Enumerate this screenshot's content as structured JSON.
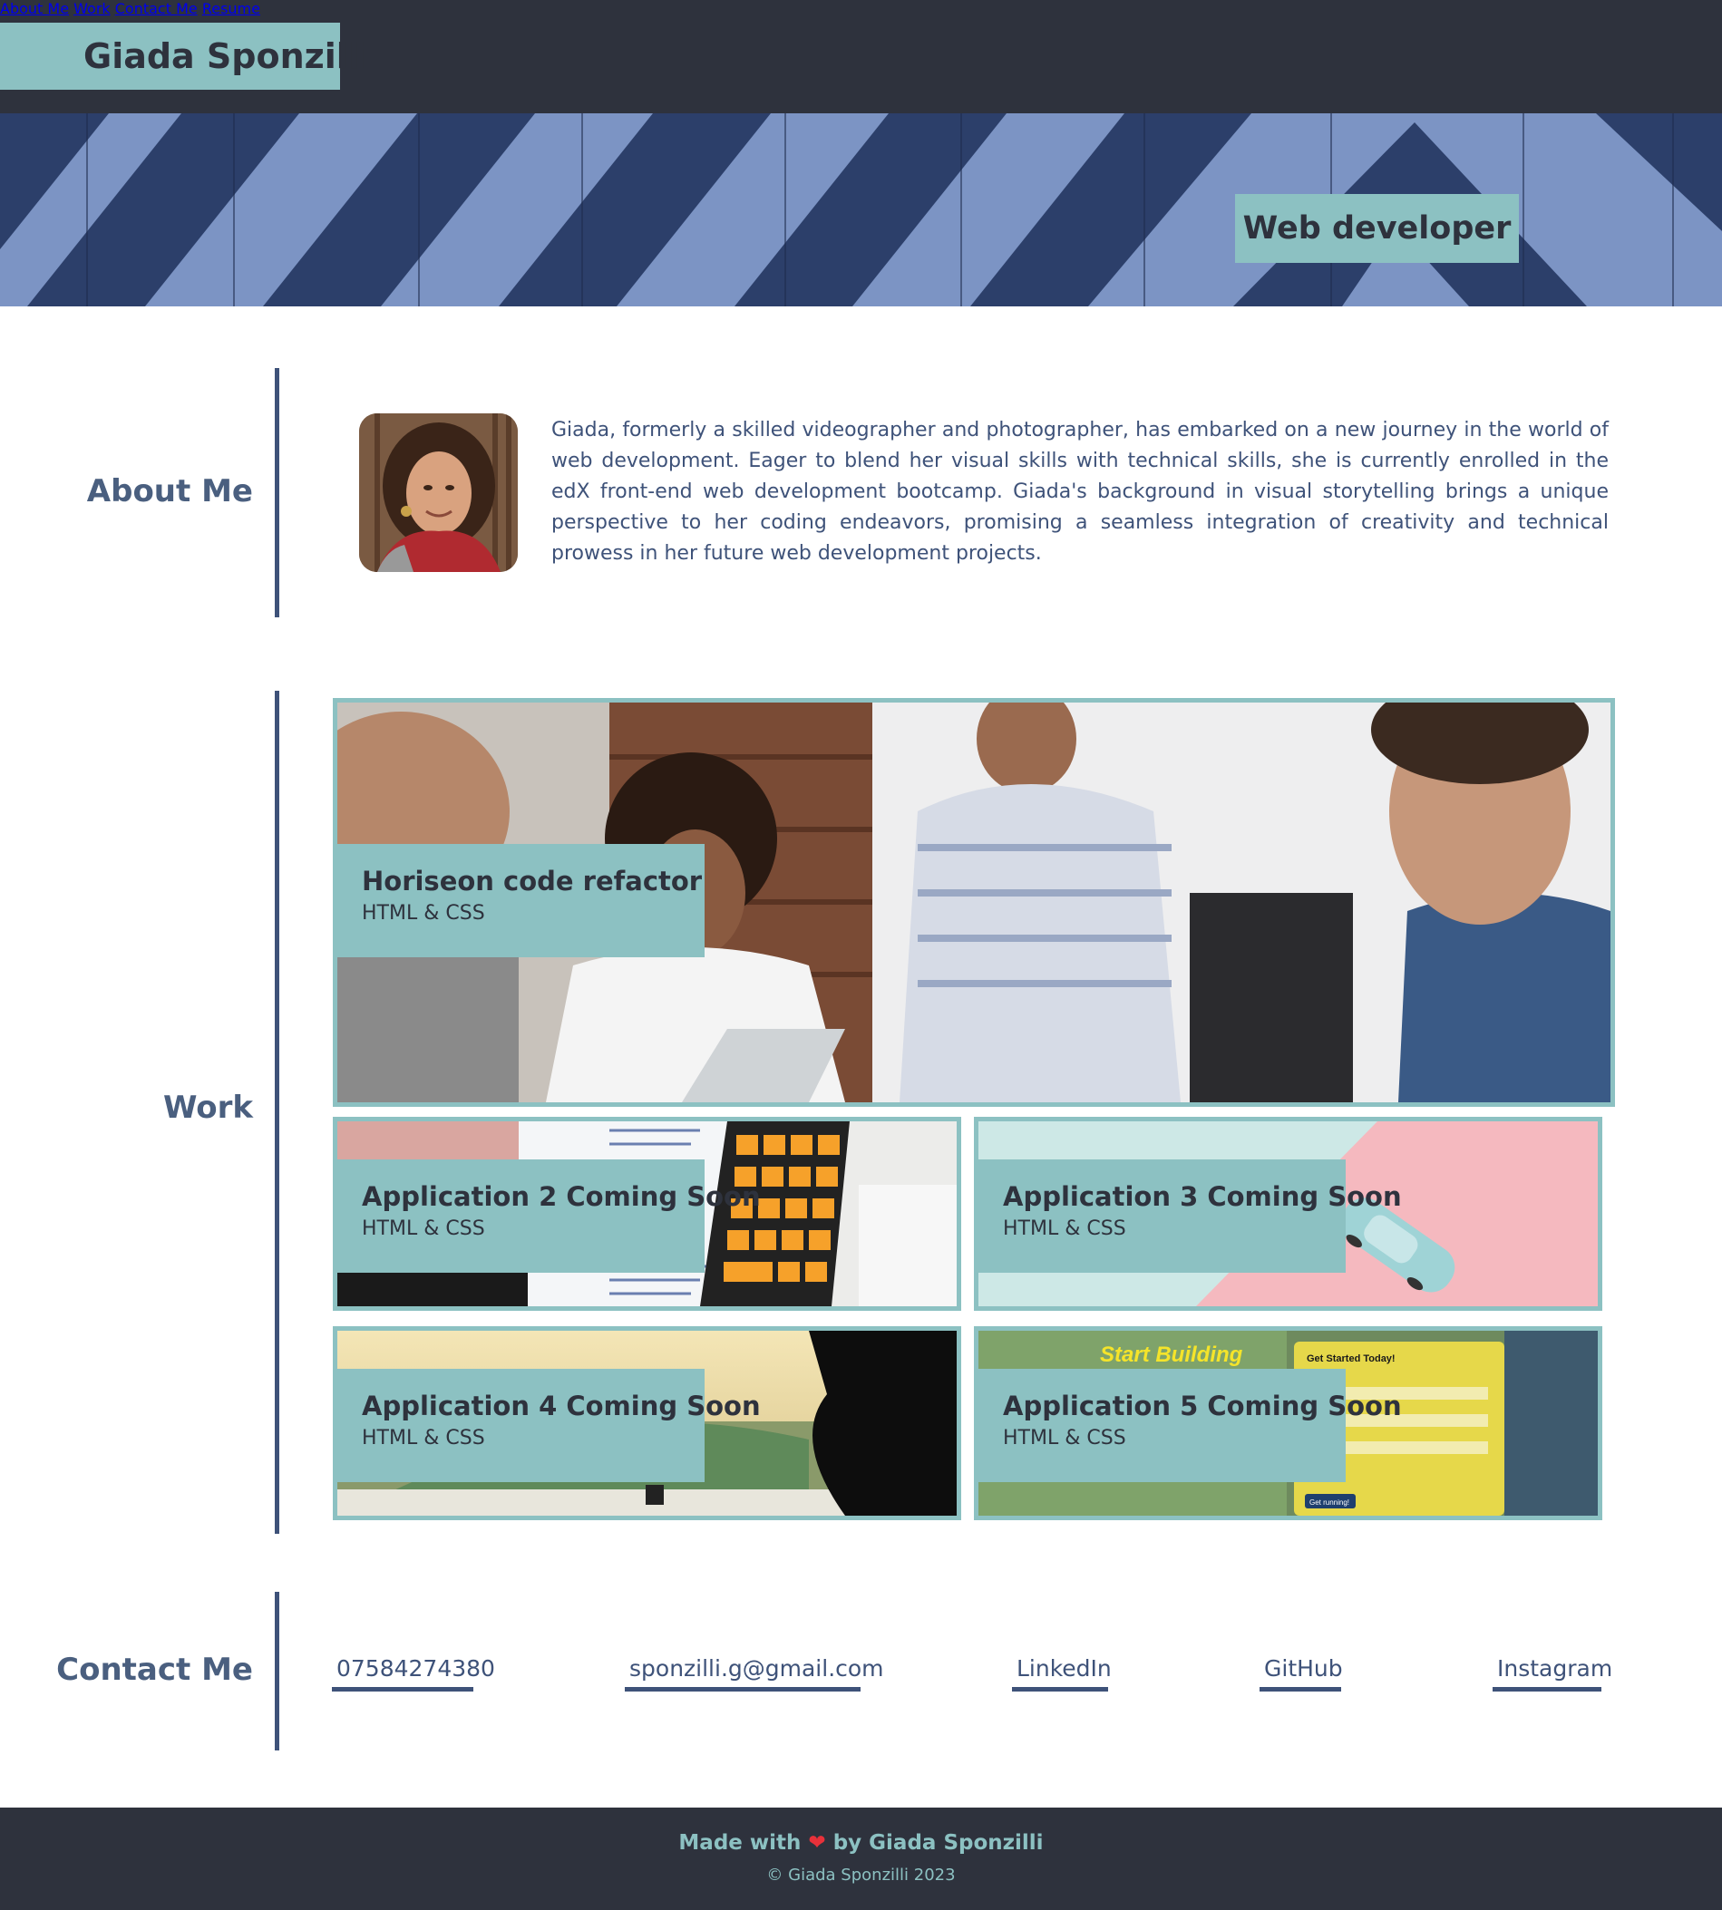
{
  "header": {
    "brand": "Giada Sponzilli",
    "nav": [
      "About Me",
      "Work",
      "Contact Me",
      "Resume"
    ]
  },
  "hero": {
    "badge": "Web developer"
  },
  "about": {
    "title": "About Me",
    "text": "Giada, formerly a skilled videographer and photographer, has embarked on a new journey in the world of web development. Eager to blend her visual skills with technical skills, she is currently enrolled in the edX front-end web development bootcamp. Giada's background in visual storytelling brings a unique perspective to her coding endeavors, promising a seamless integration of creativity and technical prowess in her future web development projects."
  },
  "work": {
    "title": "Work",
    "projects": [
      {
        "title": "Horiseon code refactor",
        "tech": "HTML & CSS"
      },
      {
        "title": "Application 2 Coming Soon",
        "tech": "HTML & CSS"
      },
      {
        "title": "Application 3 Coming Soon",
        "tech": "HTML & CSS"
      },
      {
        "title": "Application 4 Coming Soon",
        "tech": "HTML & CSS"
      },
      {
        "title": "Application 5 Coming Soon",
        "tech": "HTML & CSS"
      }
    ],
    "screenshot_text": {
      "start_building": "Start Building",
      "get_started": "Get Started Today!",
      "get_running": "Get running!"
    }
  },
  "contact": {
    "title": "Contact Me",
    "links": [
      "07584274380",
      "sponzilli.g@gmail.com",
      "LinkedIn",
      "GitHub",
      "Instagram"
    ]
  },
  "footer": {
    "made_prefix": "Made with",
    "made_suffix": "by Giada Sponzilli",
    "copyright": "© Giada Sponzilli 2023"
  },
  "colors": {
    "header_bg": "#2e323d",
    "accent": "#8cc1c2",
    "text_blue": "#3e5279",
    "heart": "#e8313a"
  }
}
